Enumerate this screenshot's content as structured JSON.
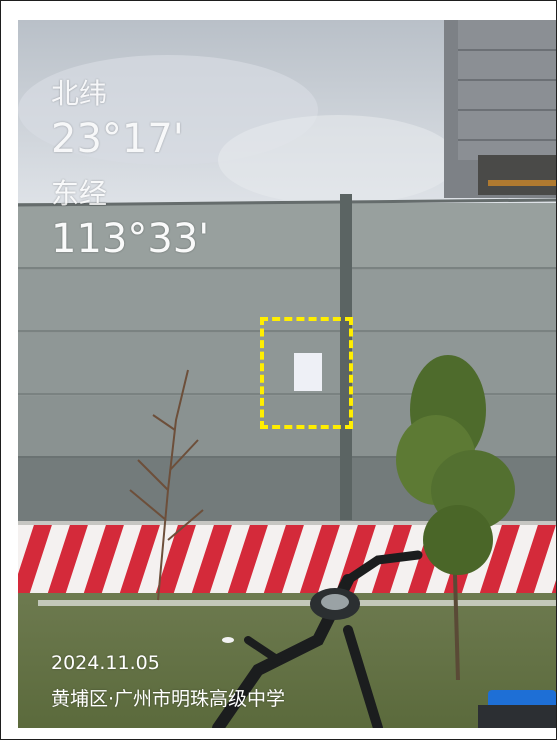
{
  "photo": {
    "watermark": {
      "latitude_label": "北纬",
      "latitude_value": "23°17'",
      "longitude_label": "东经",
      "longitude_value": "113°33'",
      "date": "2024.11.05",
      "location": "黄埔区·广州市明珠高级中学"
    },
    "colors": {
      "highlight_box": "#ffee00",
      "barrier_red": "#d42a3a",
      "wall_gray": "#8e9594"
    }
  }
}
